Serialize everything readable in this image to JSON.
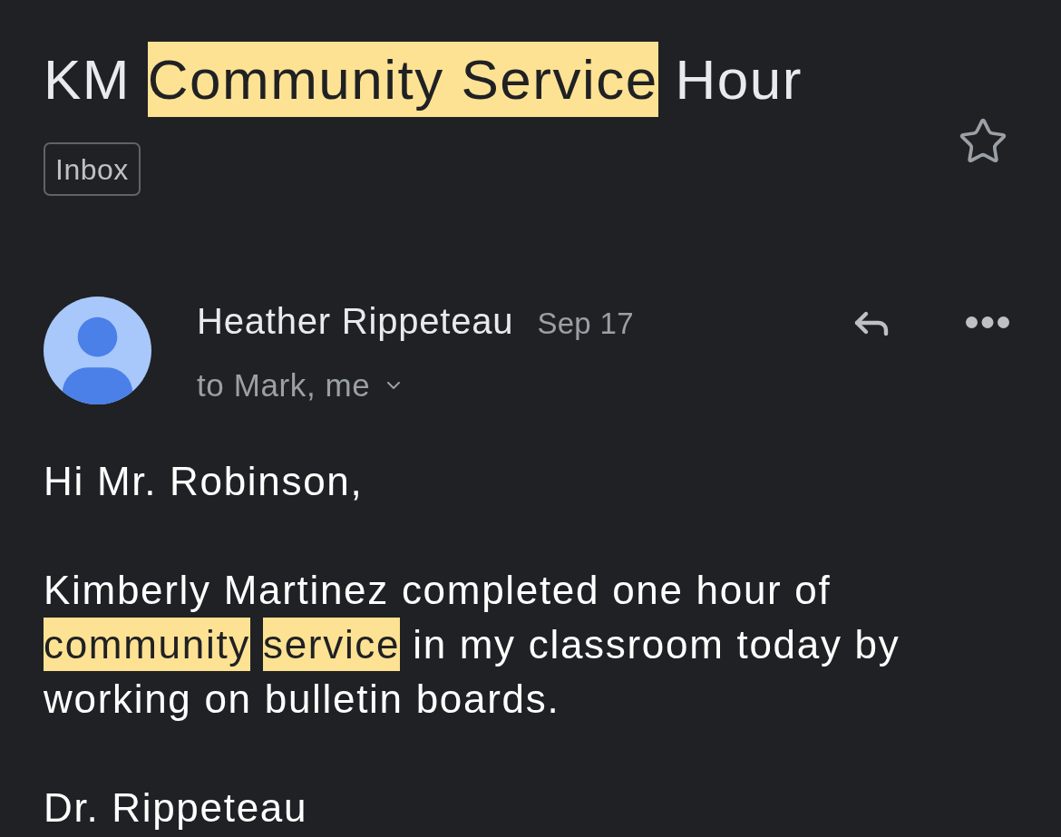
{
  "subject": {
    "segments": [
      {
        "text": "KM",
        "highlighted": false
      },
      {
        "text": "Community Service",
        "highlighted": true
      },
      {
        "text": "Hour",
        "highlighted": false
      }
    ],
    "label": "Inbox",
    "starred": false
  },
  "message": {
    "sender": "Heather Rippeteau",
    "date": "Sep 17",
    "recipients": "to Mark, me",
    "paragraphs": [
      {
        "segments": [
          {
            "text": "Hi Mr. Robinson,",
            "highlighted": false
          }
        ]
      },
      {
        "segments": [
          {
            "text": "Kimberly Martinez completed one hour of",
            "highlighted": false
          },
          {
            "text": "community",
            "highlighted": true
          },
          {
            "text": "service",
            "highlighted": true
          },
          {
            "text": "in my classroom today by working on bulletin boards.",
            "highlighted": false
          }
        ]
      },
      {
        "segments": [
          {
            "text": "Dr. Rippeteau",
            "highlighted": false
          }
        ]
      }
    ]
  }
}
